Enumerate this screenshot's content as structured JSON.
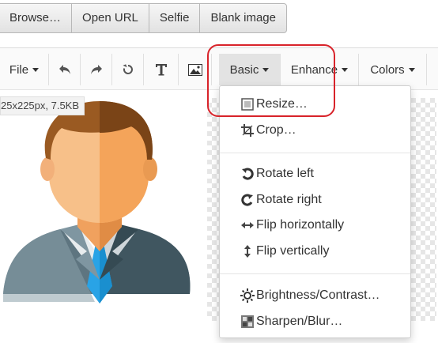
{
  "source_buttons": [
    "Browse…",
    "Open URL",
    "Selfie",
    "Blank image"
  ],
  "toolbar": {
    "file_label": "File",
    "basic_label": "Basic",
    "enhance_label": "Enhance",
    "colors_label": "Colors",
    "icons": [
      "undo-icon",
      "redo-icon",
      "reset-icon",
      "text-icon",
      "image-icon"
    ]
  },
  "image_info": "25x225px, 7.5KB",
  "basic_menu": {
    "items": [
      {
        "label": "Resize…",
        "icon": "resize-icon"
      },
      {
        "label": "Crop…",
        "icon": "crop-icon"
      },
      {
        "label": "Rotate left",
        "icon": "rotate-left-icon"
      },
      {
        "label": "Rotate right",
        "icon": "rotate-right-icon"
      },
      {
        "label": "Flip horizontally",
        "icon": "flip-horizontal-icon"
      },
      {
        "label": "Flip vertically",
        "icon": "flip-vertical-icon"
      },
      {
        "label": "Brightness/Contrast…",
        "icon": "brightness-icon"
      },
      {
        "label": "Sharpen/Blur…",
        "icon": "sharpen-icon"
      }
    ]
  },
  "colors": {
    "highlight": "#d8232a",
    "active_menu_bg": "#e3e3e3",
    "tie": "#29a3e6",
    "hair": "#9a5a22",
    "skin": "#f4a45a",
    "suit": "#4f6772"
  }
}
